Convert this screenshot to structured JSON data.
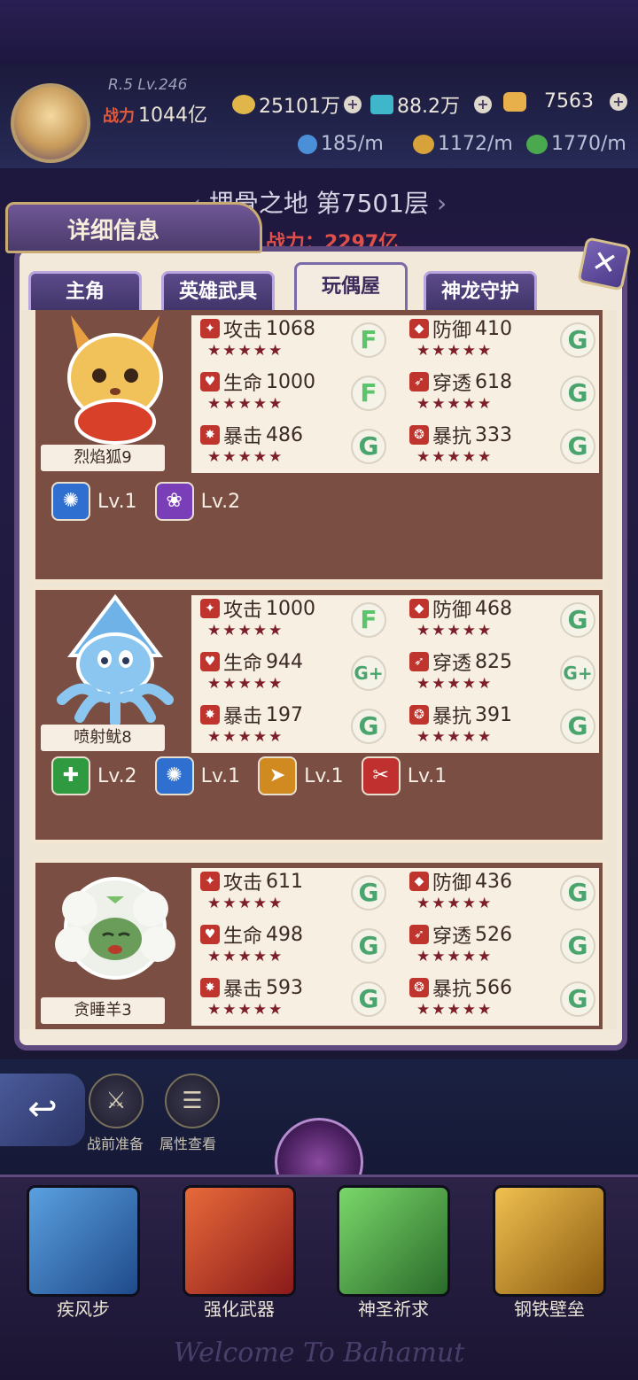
{
  "player": {
    "level": "R.5 Lv.246",
    "power_label": "战力",
    "power": "1044亿"
  },
  "resources": [
    {
      "name": "gold",
      "value": "25101万",
      "color": "#e0b64a"
    },
    {
      "name": "gem",
      "value": "88.2万",
      "color": "#3fb6c9"
    },
    {
      "name": "crystal",
      "value": "7563",
      "color": "#e8b04a"
    }
  ],
  "rates": [
    {
      "name": "gem-rate",
      "value": "185/m",
      "color": "#4a8fd8"
    },
    {
      "name": "gold-rate",
      "value": "1172/m",
      "color": "#d8a23a"
    },
    {
      "name": "exp-rate",
      "value": "1770/m",
      "color": "#4aa84f"
    }
  ],
  "stage": {
    "name": "埋骨之地 第7501层",
    "power_label": "战力：2297亿"
  },
  "panel": {
    "title": "详细信息"
  },
  "tabs": [
    {
      "label": "主角",
      "active": false
    },
    {
      "label": "英雄武具",
      "active": false
    },
    {
      "label": "玩偶屋",
      "active": true
    },
    {
      "label": "神龙守护",
      "active": false
    }
  ],
  "dolls": [
    {
      "name": "烈焰狐9",
      "stats": [
        {
          "label": "攻击",
          "value": "1068",
          "grade": "F"
        },
        {
          "label": "防御",
          "value": "410",
          "grade": "G"
        },
        {
          "label": "生命",
          "value": "1000",
          "grade": "F"
        },
        {
          "label": "穿透",
          "value": "618",
          "grade": "G"
        },
        {
          "label": "暴击",
          "value": "486",
          "grade": "G"
        },
        {
          "label": "暴抗",
          "value": "333",
          "grade": "G"
        }
      ],
      "skills": [
        {
          "level": "Lv.1",
          "color": "#2f6fd0"
        },
        {
          "level": "Lv.2",
          "color": "#7a3fb8"
        }
      ]
    },
    {
      "name": "喷射鱿8",
      "stats": [
        {
          "label": "攻击",
          "value": "1000",
          "grade": "F"
        },
        {
          "label": "防御",
          "value": "468",
          "grade": "G"
        },
        {
          "label": "生命",
          "value": "944",
          "grade": "G+"
        },
        {
          "label": "穿透",
          "value": "825",
          "grade": "G+"
        },
        {
          "label": "暴击",
          "value": "197",
          "grade": "G"
        },
        {
          "label": "暴抗",
          "value": "391",
          "grade": "G"
        }
      ],
      "skills": [
        {
          "level": "Lv.2",
          "color": "#2f9a3f"
        },
        {
          "level": "Lv.1",
          "color": "#2f6fd0"
        },
        {
          "level": "Lv.1",
          "color": "#d08a1f"
        },
        {
          "level": "Lv.1",
          "color": "#c0302e"
        }
      ]
    },
    {
      "name": "贪睡羊3",
      "stats": [
        {
          "label": "攻击",
          "value": "611",
          "grade": "G"
        },
        {
          "label": "防御",
          "value": "436",
          "grade": "G"
        },
        {
          "label": "生命",
          "value": "498",
          "grade": "G"
        },
        {
          "label": "穿透",
          "value": "526",
          "grade": "G"
        },
        {
          "label": "暴击",
          "value": "593",
          "grade": "G"
        },
        {
          "label": "暴抗",
          "value": "566",
          "grade": "G"
        }
      ],
      "skills": []
    }
  ],
  "bottom": {
    "side_buttons": [
      {
        "label": "战前准备"
      },
      {
        "label": "属性查看"
      }
    ],
    "slots": [
      {
        "label": "疾风步",
        "color": "#3f7fc4"
      },
      {
        "label": "强化武器",
        "color": "#c43a2a"
      },
      {
        "label": "神圣祈求",
        "color": "#4fa84a"
      },
      {
        "label": "钢铁壁垒",
        "color": "#d0a030"
      }
    ],
    "footer": "Welcome To Bahamut"
  }
}
